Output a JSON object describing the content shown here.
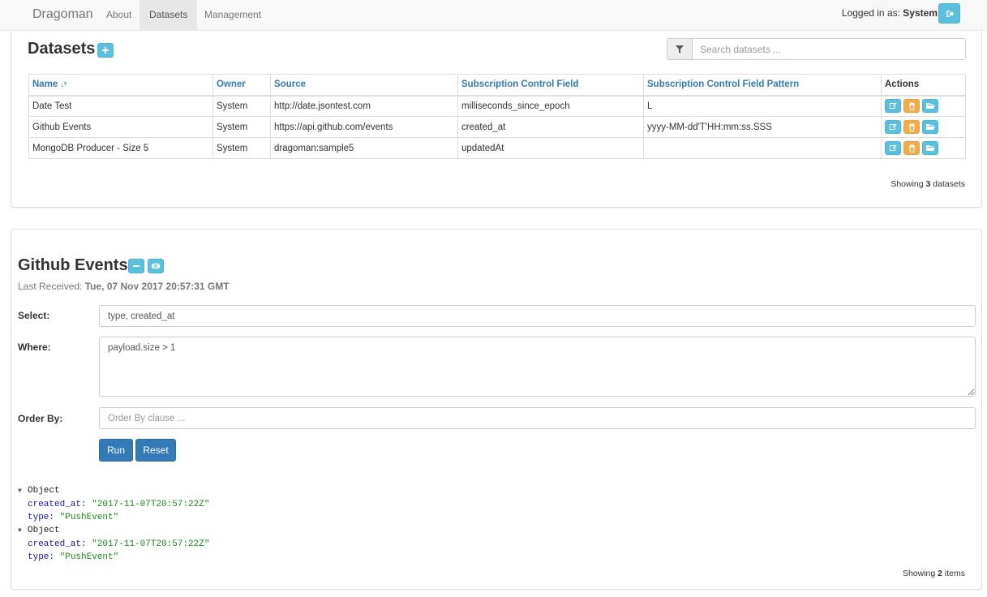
{
  "nav": {
    "brand": "Dragoman",
    "items": [
      {
        "label": "About"
      },
      {
        "label": "Datasets"
      },
      {
        "label": "Management"
      }
    ],
    "logged_prefix": "Logged in as: ",
    "user": "System"
  },
  "datasets": {
    "title": "Datasets",
    "search_placeholder": "Search datasets ...",
    "columns": [
      "Name",
      "Owner",
      "Source",
      "Subscription Control Field",
      "Subscription Control Field Pattern",
      "Actions"
    ],
    "sort_indicator": "↓²",
    "rows": [
      {
        "name": "Date Test",
        "owner": "System",
        "source": "http://date.jsontest.com",
        "field": "milliseconds_since_epoch",
        "pattern": "L"
      },
      {
        "name": "Github Events",
        "owner": "System",
        "source": "https://api.github.com/events",
        "field": "created_at",
        "pattern": "yyyy-MM-dd'T'HH:mm:ss.SSS"
      },
      {
        "name": "MongoDB Producer - Size 5",
        "owner": "System",
        "source": "dragoman:sample5",
        "field": "updatedAt",
        "pattern": ""
      }
    ],
    "showing_prefix": "Showing ",
    "showing_count": "3",
    "showing_suffix": " datasets"
  },
  "query": {
    "title": "Github Events",
    "last_received_label": "Last Received: ",
    "last_received_value": "Tue, 07 Nov 2017 20:57:31 GMT",
    "select_label": "Select:",
    "select_value": "type, created_at",
    "where_label": "Where:",
    "where_value": "payload.size > 1",
    "orderby_label": "Order By:",
    "orderby_placeholder": "Order By clause ...",
    "run_label": "Run",
    "reset_label": "Reset",
    "results": [
      {
        "label": "Object",
        "created_at": "\"2017-11-07T20:57:22Z\"",
        "type": "\"PushEvent\""
      },
      {
        "label": "Object",
        "created_at": "\"2017-11-07T20:57:22Z\"",
        "type": "\"PushEvent\""
      }
    ],
    "key_created_at": "created_at:",
    "key_type": "type:",
    "showing_prefix": "Showing ",
    "showing_count": "2",
    "showing_suffix": " items"
  },
  "icons": [
    "plus-icon",
    "filter-icon",
    "edit-icon",
    "trash-icon",
    "folder-open-icon",
    "minus-icon",
    "eye-icon",
    "logout-icon",
    "collapse-triangle-icon"
  ],
  "colors": {
    "info": "#5bc0de",
    "warning": "#f0ad4e",
    "primary": "#337ab7",
    "link": "#337ab7"
  }
}
